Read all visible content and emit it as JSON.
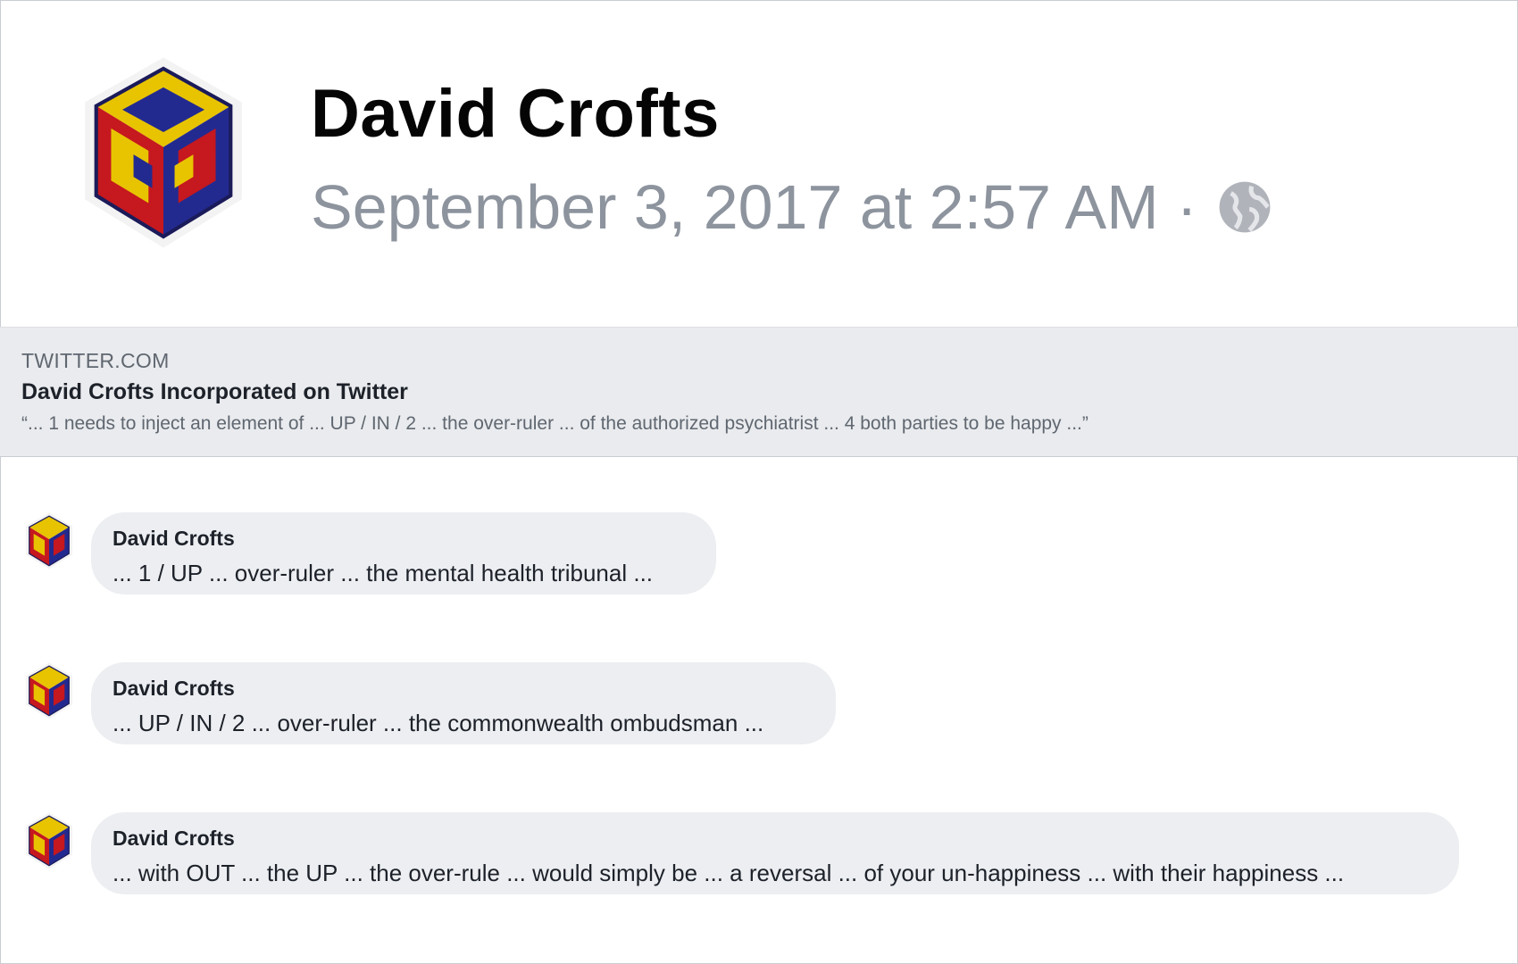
{
  "post": {
    "author": "David Crofts",
    "timestamp": "September 3, 2017 at 2:57 AM",
    "separator": "·",
    "privacy_icon": "globe-icon"
  },
  "link_preview": {
    "domain": "TWITTER.COM",
    "title": "David Crofts Incorporated on Twitter",
    "description": "“... 1 needs to inject an element of ... UP / IN / 2 ... the over-ruler ... of the authorized psychiatrist ... 4 both parties to be happy ...”"
  },
  "comments": [
    {
      "author": "David Crofts",
      "text": "... 1 / UP ... over-ruler ... the mental health tribunal ..."
    },
    {
      "author": "David Crofts",
      "text": "... UP / IN / 2 ... over-ruler ... the commonwealth ombudsman ..."
    },
    {
      "author": "David Crofts",
      "text": "... with OUT ... the UP ... the over-rule ... would simply be ... a reversal ... of your un-happiness ... with their happiness ..."
    }
  ],
  "colors": {
    "name_text": "#050505",
    "meta_text": "#8d949e",
    "preview_bg": "#e9ebee",
    "bubble_bg": "#eceef1"
  }
}
